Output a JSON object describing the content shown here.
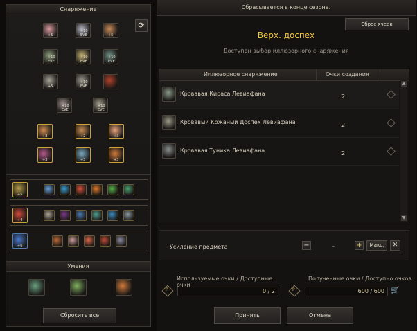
{
  "equipment": {
    "title": "Снаряжение",
    "items": [
      {
        "color": "#d89aa0",
        "lvl": "+5"
      },
      {
        "color": "#b6b7c6",
        "lvl": "+10 EVE"
      },
      {
        "color": "#c98c5a",
        "lvl": "+5"
      },
      {
        "color": "#8a9a7a",
        "lvl": "+10 EVE"
      },
      {
        "color": "#c2b070",
        "lvl": "+10 EVE"
      },
      {
        "color": "#6f8f86",
        "lvl": "+10 EVE"
      },
      {
        "color": "#a6a59a",
        "lvl": "+5"
      },
      {
        "color": "#9e9c92",
        "lvl": "+10 EVE"
      },
      {
        "color": "#b2422c",
        "lvl": ""
      },
      {
        "color": "#9b8d8a",
        "lvl": "+10 EVE"
      },
      {
        "color": "#9f9a8a",
        "lvl": "+10 EVE"
      },
      {
        "color": "#cf8c50",
        "lvl": "+3"
      },
      {
        "color": "#c48b50",
        "lvl": "+2"
      },
      {
        "color": "#e8a27a",
        "lvl": "+3"
      },
      {
        "color": "#b25a8a",
        "lvl": "+3"
      },
      {
        "color": "#7aa8c0",
        "lvl": "+3"
      },
      {
        "color": "#d07a3a",
        "lvl": "+3"
      }
    ]
  },
  "sets": [
    {
      "main": "#b69a4a",
      "main_lvl": "+5",
      "items": [
        "#6aa0d8",
        "#3a9ad0",
        "#d8503a",
        "#e07a2a",
        "#58b048",
        "#4aa070"
      ]
    },
    {
      "main": "#d04a3a",
      "main_lvl": "+4",
      "items": [
        "#b0a898",
        "#7a3a8a",
        "#4a7ab0",
        "#50a090",
        "#3a8ac0",
        "#8a9aa0"
      ]
    },
    {
      "main": "#4a7ad0",
      "main_lvl": "+6",
      "items": [
        "#c06a3a",
        "#d0a0a0",
        "#e06a4a",
        "#c04a3a",
        "#8a8aa0"
      ]
    }
  ],
  "skills": {
    "title": "Умения",
    "items": [
      "#6aa080",
      "#80b060",
      "#d07a3a"
    ]
  },
  "left_buttons": {
    "reset_all": "Сбросить все"
  },
  "main": {
    "season_notice": "Сбрасывается в конце сезона.",
    "reset_cells": "Сброс ячеек",
    "category_title": "Верх. доспех",
    "subtitle": "Доступен выбор иллюзорного снаряжения",
    "table": {
      "col_illusion": "Иллюзорное снаряжение",
      "col_points": "Очки создания",
      "rows": [
        {
          "name": "Кровавая Кираса Левиафана",
          "points": "2",
          "color": "#8a9a8a"
        },
        {
          "name": "Кровавый Кожаный Доспех Левиафана",
          "points": "2",
          "color": "#9a9a88"
        },
        {
          "name": "Кровавая Туника Левиафана",
          "points": "2",
          "color": "#8a9090"
        }
      ]
    },
    "enhance": {
      "label": "Усиление предмета",
      "minus": "−",
      "value": "-",
      "plus": "+",
      "max": "Макс.",
      "close": "✕"
    },
    "points_used": {
      "label": "Используемые очки  /  Доступные очки",
      "value": "0 / 2",
      "icon": "P"
    },
    "points_got": {
      "label": "Полученные очки  /  Доступно очков",
      "value": "600 / 600",
      "icon": "P"
    },
    "accept": "Принять",
    "cancel": "Отмена"
  }
}
